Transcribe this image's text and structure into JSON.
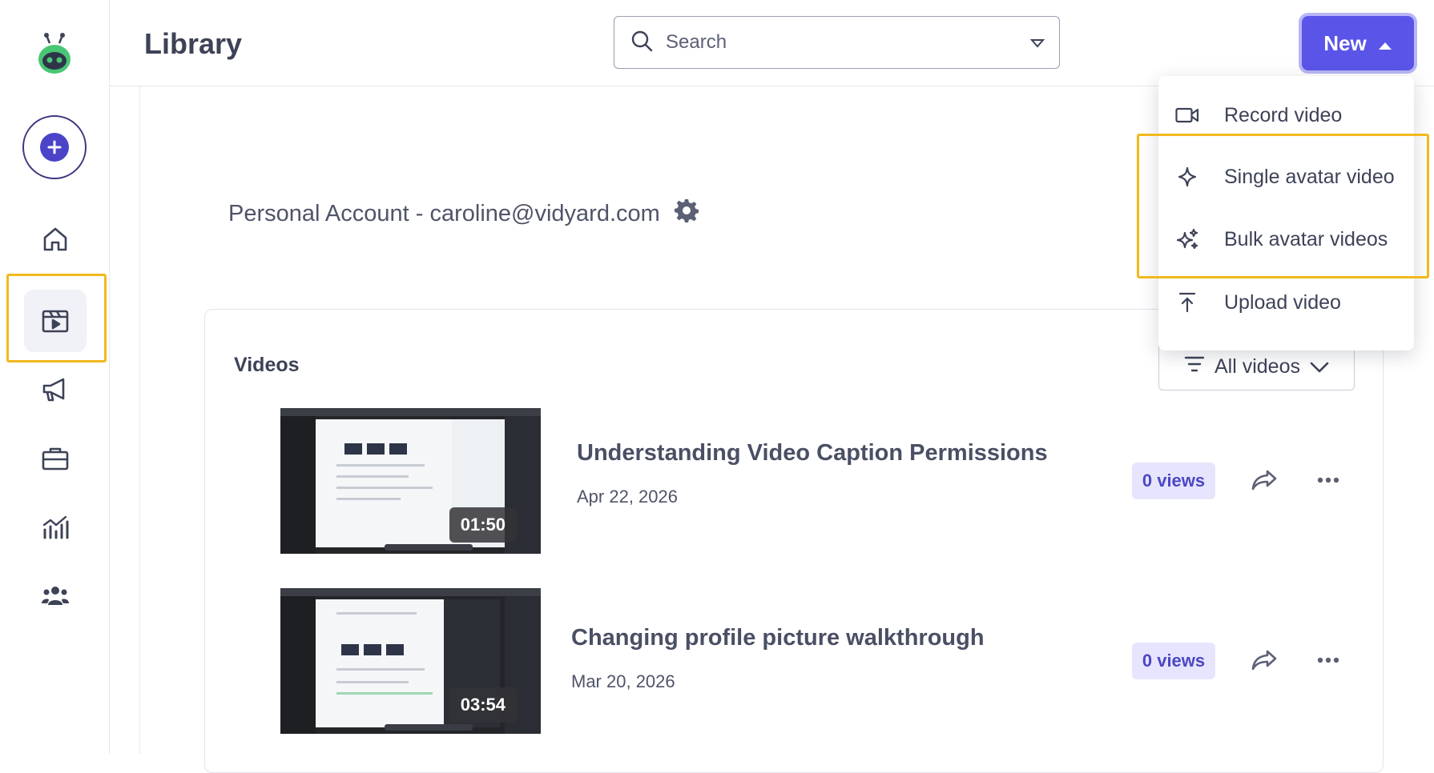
{
  "header": {
    "title": "Library",
    "search_placeholder": "Search",
    "new_label": "New"
  },
  "menu": {
    "items": [
      {
        "label": "Record video",
        "icon": "video-camera-icon"
      },
      {
        "label": "Single avatar video",
        "icon": "sparkle-icon"
      },
      {
        "label": "Bulk avatar videos",
        "icon": "sparkles-icon"
      },
      {
        "label": "Upload video",
        "icon": "upload-icon"
      }
    ]
  },
  "sidebar": {
    "items": [
      {
        "name": "home",
        "icon": "home-icon"
      },
      {
        "name": "library",
        "icon": "clapperboard-icon",
        "active": true
      },
      {
        "name": "campaigns",
        "icon": "megaphone-icon"
      },
      {
        "name": "hubs",
        "icon": "briefcase-icon"
      },
      {
        "name": "analytics",
        "icon": "bar-chart-icon"
      },
      {
        "name": "team",
        "icon": "people-icon"
      }
    ]
  },
  "account": {
    "label": "Personal Account - caroline@vidyard.com"
  },
  "videos": {
    "section_title": "Videos",
    "filter_label": "All videos",
    "items": [
      {
        "title": "Understanding Video Caption Permissions",
        "date": "Apr 22, 2026",
        "duration": "01:50",
        "views": "0 views"
      },
      {
        "title": "Changing profile picture walkthrough",
        "date": "Mar 20, 2026",
        "duration": "03:54",
        "views": "0 views"
      }
    ]
  },
  "colors": {
    "accent": "#5a55e8",
    "highlight": "#f2b81d",
    "views_bg": "#e6e5fd"
  }
}
